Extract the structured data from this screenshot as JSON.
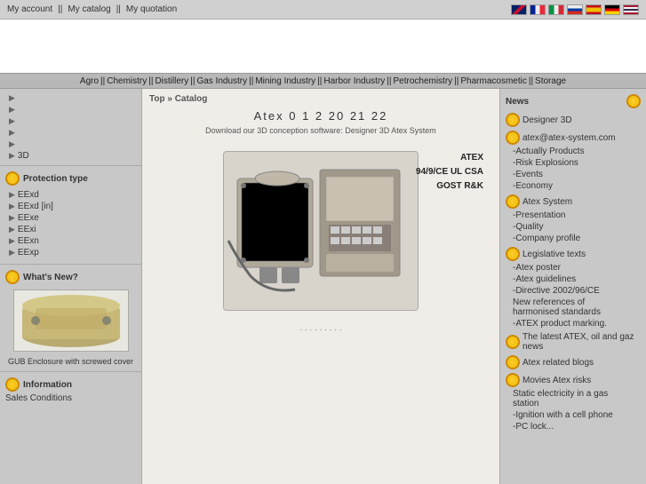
{
  "topbar": {
    "links": [
      "My account",
      "My catalog",
      "My quotation"
    ],
    "separator": "||"
  },
  "languages": [
    "UK",
    "FR",
    "IT",
    "RU",
    "ES",
    "DE",
    "TH"
  ],
  "navbar": {
    "items": [
      "Agro",
      "Chemistry",
      "Distillery",
      "Gas Industry",
      "Mining Industry",
      "Harbor Industry",
      "Petrochemistry",
      "Pharmacosmetic",
      "Storage"
    ],
    "separator": "||"
  },
  "breadcrumb": "Top » Catalog",
  "center": {
    "title": "Atex        0 1 2    20 21 22",
    "subtitle": "Download our 3D conception software: Designer 3D Atex System",
    "certifications": [
      "ATEX",
      "94/9/CE   UL    CSA",
      "GOST       R&K"
    ],
    "product_dots": ". . . . . . . . ."
  },
  "sidebar_left": {
    "main_items": [
      "3D"
    ],
    "arrows": [
      "▶",
      "▶",
      "▶",
      "▶",
      "▶"
    ],
    "protection": {
      "title": "Protection type",
      "items": [
        "EExd",
        "EExd [in]",
        "EExe",
        "EExi",
        "EExn",
        "EExp"
      ]
    },
    "whats_new": {
      "title": "What's New?",
      "caption": "GUB Enclosure with screwed cover"
    },
    "information": {
      "title": "Information",
      "items": [
        "Sales Conditions"
      ]
    }
  },
  "sidebar_right": {
    "news_label": "News",
    "sections": [
      {
        "type": "icon-item",
        "label": "Designer 3D"
      },
      {
        "type": "icon-item",
        "label": "atex@atex-system.com"
      },
      {
        "type": "sub-item",
        "label": "-Actually Products"
      },
      {
        "type": "sub-item",
        "label": "-Risk Explosions"
      },
      {
        "type": "sub-item",
        "label": "-Events"
      },
      {
        "type": "sub-item",
        "label": "-Economy"
      },
      {
        "type": "icon-item",
        "label": "Atex System"
      },
      {
        "type": "sub-item",
        "label": "-Presentation"
      },
      {
        "type": "sub-item",
        "label": "-Quality"
      },
      {
        "type": "sub-item",
        "label": "-Company profile"
      },
      {
        "type": "icon-item",
        "label": "Legislative texts"
      },
      {
        "type": "sub-item",
        "label": "-Atex poster"
      },
      {
        "type": "sub-item",
        "label": "-Atex guidelines"
      },
      {
        "type": "sub-item",
        "label": "-Directive 2002/96/CE"
      },
      {
        "type": "sub-item",
        "label": "New references of harmonised standards"
      },
      {
        "type": "sub-item",
        "label": "-ATEX product marking."
      },
      {
        "type": "icon-item",
        "label": "The latest ATEX, oil and gaz news"
      },
      {
        "type": "icon-item",
        "label": "Atex related blogs"
      },
      {
        "type": "icon-item",
        "label": "Movies Atex risks"
      },
      {
        "type": "sub-item",
        "label": "Static electricity in a gas station"
      },
      {
        "type": "sub-item",
        "label": "-Ignition with a cell phone"
      },
      {
        "type": "sub-item",
        "label": "-PC lock..."
      }
    ]
  }
}
